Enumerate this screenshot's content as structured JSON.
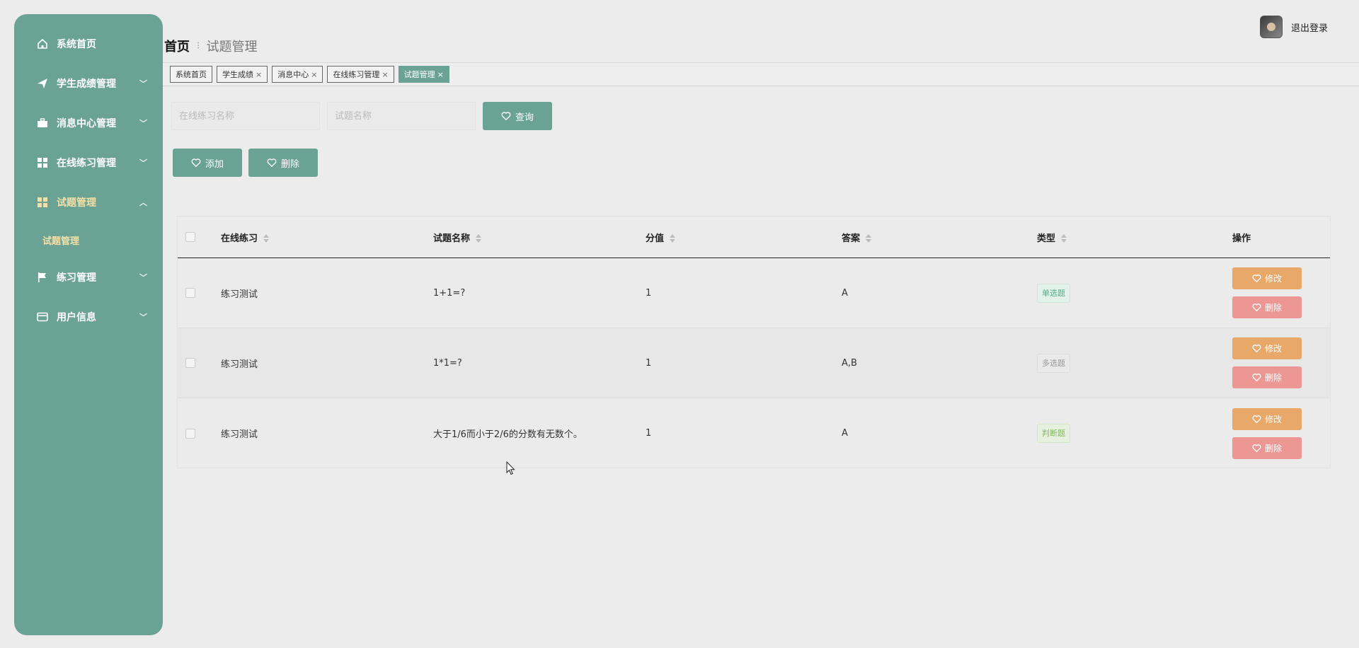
{
  "sidebar": {
    "items": [
      {
        "label": "系统首页",
        "icon": "home-icon",
        "chevron": ""
      },
      {
        "label": "学生成绩管理",
        "icon": "send-icon",
        "chevron": "﹀"
      },
      {
        "label": "消息中心管理",
        "icon": "briefcase-icon",
        "chevron": "﹀"
      },
      {
        "label": "在线练习管理",
        "icon": "grid-icon",
        "chevron": "﹀"
      },
      {
        "label": "试题管理",
        "icon": "grid-icon",
        "chevron": "︿",
        "active": true
      },
      {
        "label": "练习管理",
        "icon": "flag-icon",
        "chevron": "﹀"
      },
      {
        "label": "用户信息",
        "icon": "card-icon",
        "chevron": "﹀"
      }
    ],
    "submenu": [
      "试题管理"
    ],
    "accent": "#6aa393",
    "active_text_color": "#f3e0a8"
  },
  "breadcrumb": {
    "home": "首页",
    "separator": "⁝",
    "current": "试题管理"
  },
  "header": {
    "logout": "退出登录"
  },
  "tabs": [
    {
      "label": "系统首页",
      "closable": false,
      "active": false
    },
    {
      "label": "学生成绩",
      "closable": true,
      "active": false
    },
    {
      "label": "消息中心",
      "closable": true,
      "active": false
    },
    {
      "label": "在线练习管理",
      "closable": true,
      "active": false
    },
    {
      "label": "试题管理",
      "closable": true,
      "active": true
    }
  ],
  "tab_close": "×",
  "search": {
    "practice_placeholder": "在线练习名称",
    "question_placeholder": "试题名称",
    "query_label": "查询"
  },
  "actions": {
    "add_label": "添加",
    "delete_label": "删除"
  },
  "table": {
    "headers": [
      "在线练习",
      "试题名称",
      "分值",
      "答案",
      "类型",
      "操作"
    ],
    "rows": [
      {
        "practice": "练习测试",
        "question": "1+1=?",
        "score": "1",
        "answer": "A",
        "type": "单选题",
        "type_style": "green"
      },
      {
        "practice": "练习测试",
        "question": "1*1=?",
        "score": "1",
        "answer": "A,B",
        "type": "多选题",
        "type_style": "gray"
      },
      {
        "practice": "练习测试",
        "question": "大于1/6而小于2/6的分数有无数个。",
        "score": "1",
        "answer": "A",
        "type": "判断题",
        "type_style": "lime"
      }
    ],
    "edit_label": "修改",
    "delete_label": "删除",
    "edit_color": "#e8a86a",
    "delete_color": "#ec9794"
  }
}
